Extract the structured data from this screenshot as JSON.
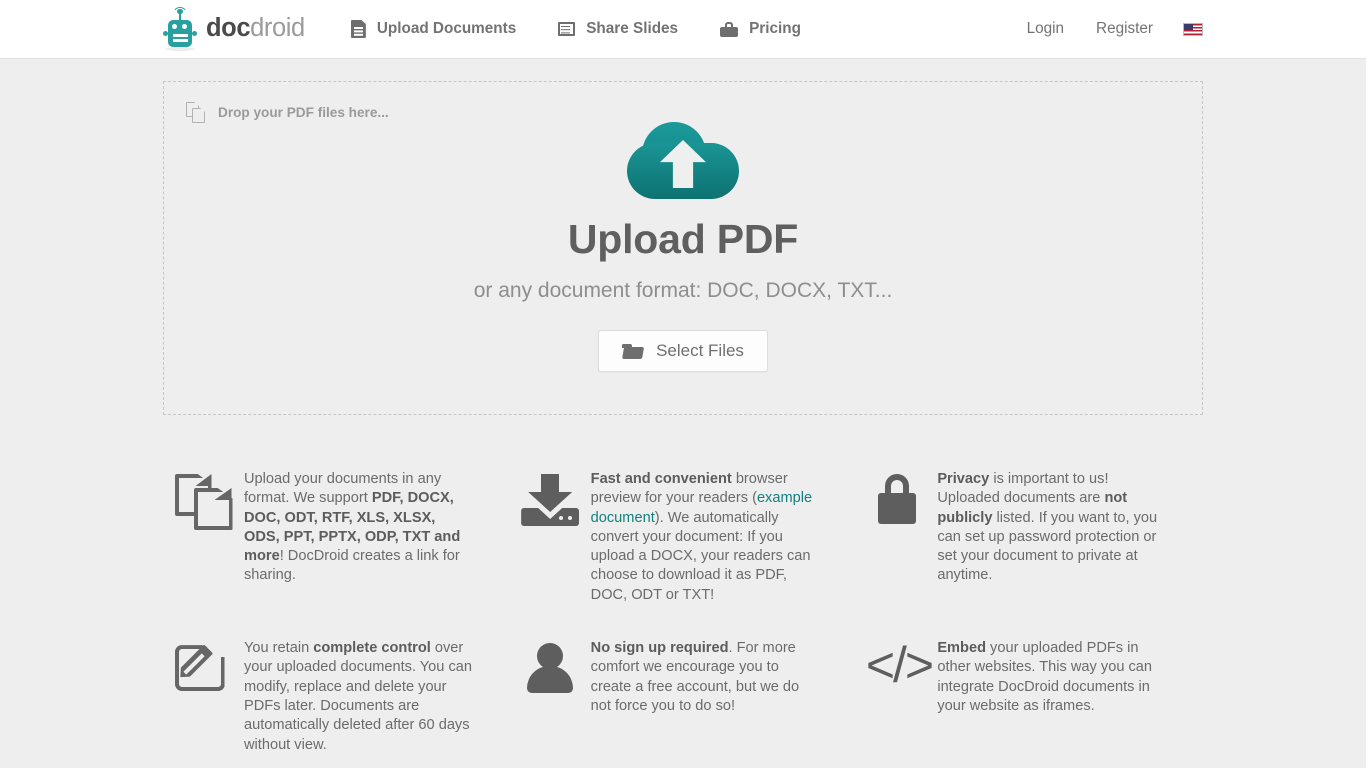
{
  "header": {
    "logo": {
      "icon": "docdroid-robot-logo-icon",
      "text_bold": "doc",
      "text_light": "droid"
    },
    "nav_main": [
      {
        "label": "Upload Documents",
        "icon": "document-file-icon"
      },
      {
        "label": "Share Slides",
        "icon": "slides-list-icon"
      },
      {
        "label": "Pricing",
        "icon": "briefcase-icon"
      }
    ],
    "nav_right": [
      {
        "label": "Login"
      },
      {
        "label": "Register"
      }
    ],
    "language_flag": "us-flag-icon"
  },
  "dropzone": {
    "hint_icon": "copy-documents-icon",
    "hint_text": "Drop your PDF files here...",
    "cloud_icon": "cloud-upload-icon",
    "title": "Upload PDF",
    "subtitle": "or any document format: DOC, DOCX, TXT...",
    "button": {
      "icon": "folder-open-icon",
      "label": "Select Files"
    },
    "accent_color": "#128080",
    "border_style": "dashed",
    "border_color": "#c6c6c6"
  },
  "features": [
    {
      "icon": "documents-outline-icon",
      "segments": [
        {
          "text": "Upload your documents in any format. We support ",
          "style": "normal"
        },
        {
          "text": "PDF, DOCX, DOC, ODT, RTF, XLS, XLSX, ODS, PPT, PPTX, ODP, TXT and more",
          "style": "bold"
        },
        {
          "text": "! DocDroid creates a link for sharing.",
          "style": "normal"
        }
      ]
    },
    {
      "icon": "download-icon",
      "segments": [
        {
          "text": "Fast and convenient",
          "style": "bold"
        },
        {
          "text": " browser preview for your readers (",
          "style": "normal"
        },
        {
          "text": "example document",
          "style": "link"
        },
        {
          "text": "). We automatically convert your document: If you upload a DOCX, your readers can choose to download it as PDF, DOC, ODT or TXT!",
          "style": "normal"
        }
      ]
    },
    {
      "icon": "lock-icon",
      "segments": [
        {
          "text": "Privacy",
          "style": "bold"
        },
        {
          "text": " is important to us! Uploaded documents are ",
          "style": "normal"
        },
        {
          "text": "not publicly",
          "style": "bold"
        },
        {
          "text": " listed. If you want to, you can set up password protection or set your document to private at anytime.",
          "style": "normal"
        }
      ]
    },
    {
      "icon": "edit-pencil-icon",
      "segments": [
        {
          "text": "You retain ",
          "style": "normal"
        },
        {
          "text": "complete control",
          "style": "bold"
        },
        {
          "text": " over your uploaded documents. You can modify, replace and delete your PDFs later. Documents are automatically deleted after 60 days without view.",
          "style": "normal"
        }
      ]
    },
    {
      "icon": "user-icon",
      "segments": [
        {
          "text": "No sign up required",
          "style": "bold"
        },
        {
          "text": ". For more comfort we encourage you to create a free account, but we do not force you to do so!",
          "style": "normal"
        }
      ]
    },
    {
      "icon": "code-embed-icon",
      "segments": [
        {
          "text": "Embed",
          "style": "bold"
        },
        {
          "text": " your uploaded PDFs in other websites. This way you can integrate DocDroid documents in your website as iframes.",
          "style": "normal"
        }
      ]
    }
  ]
}
